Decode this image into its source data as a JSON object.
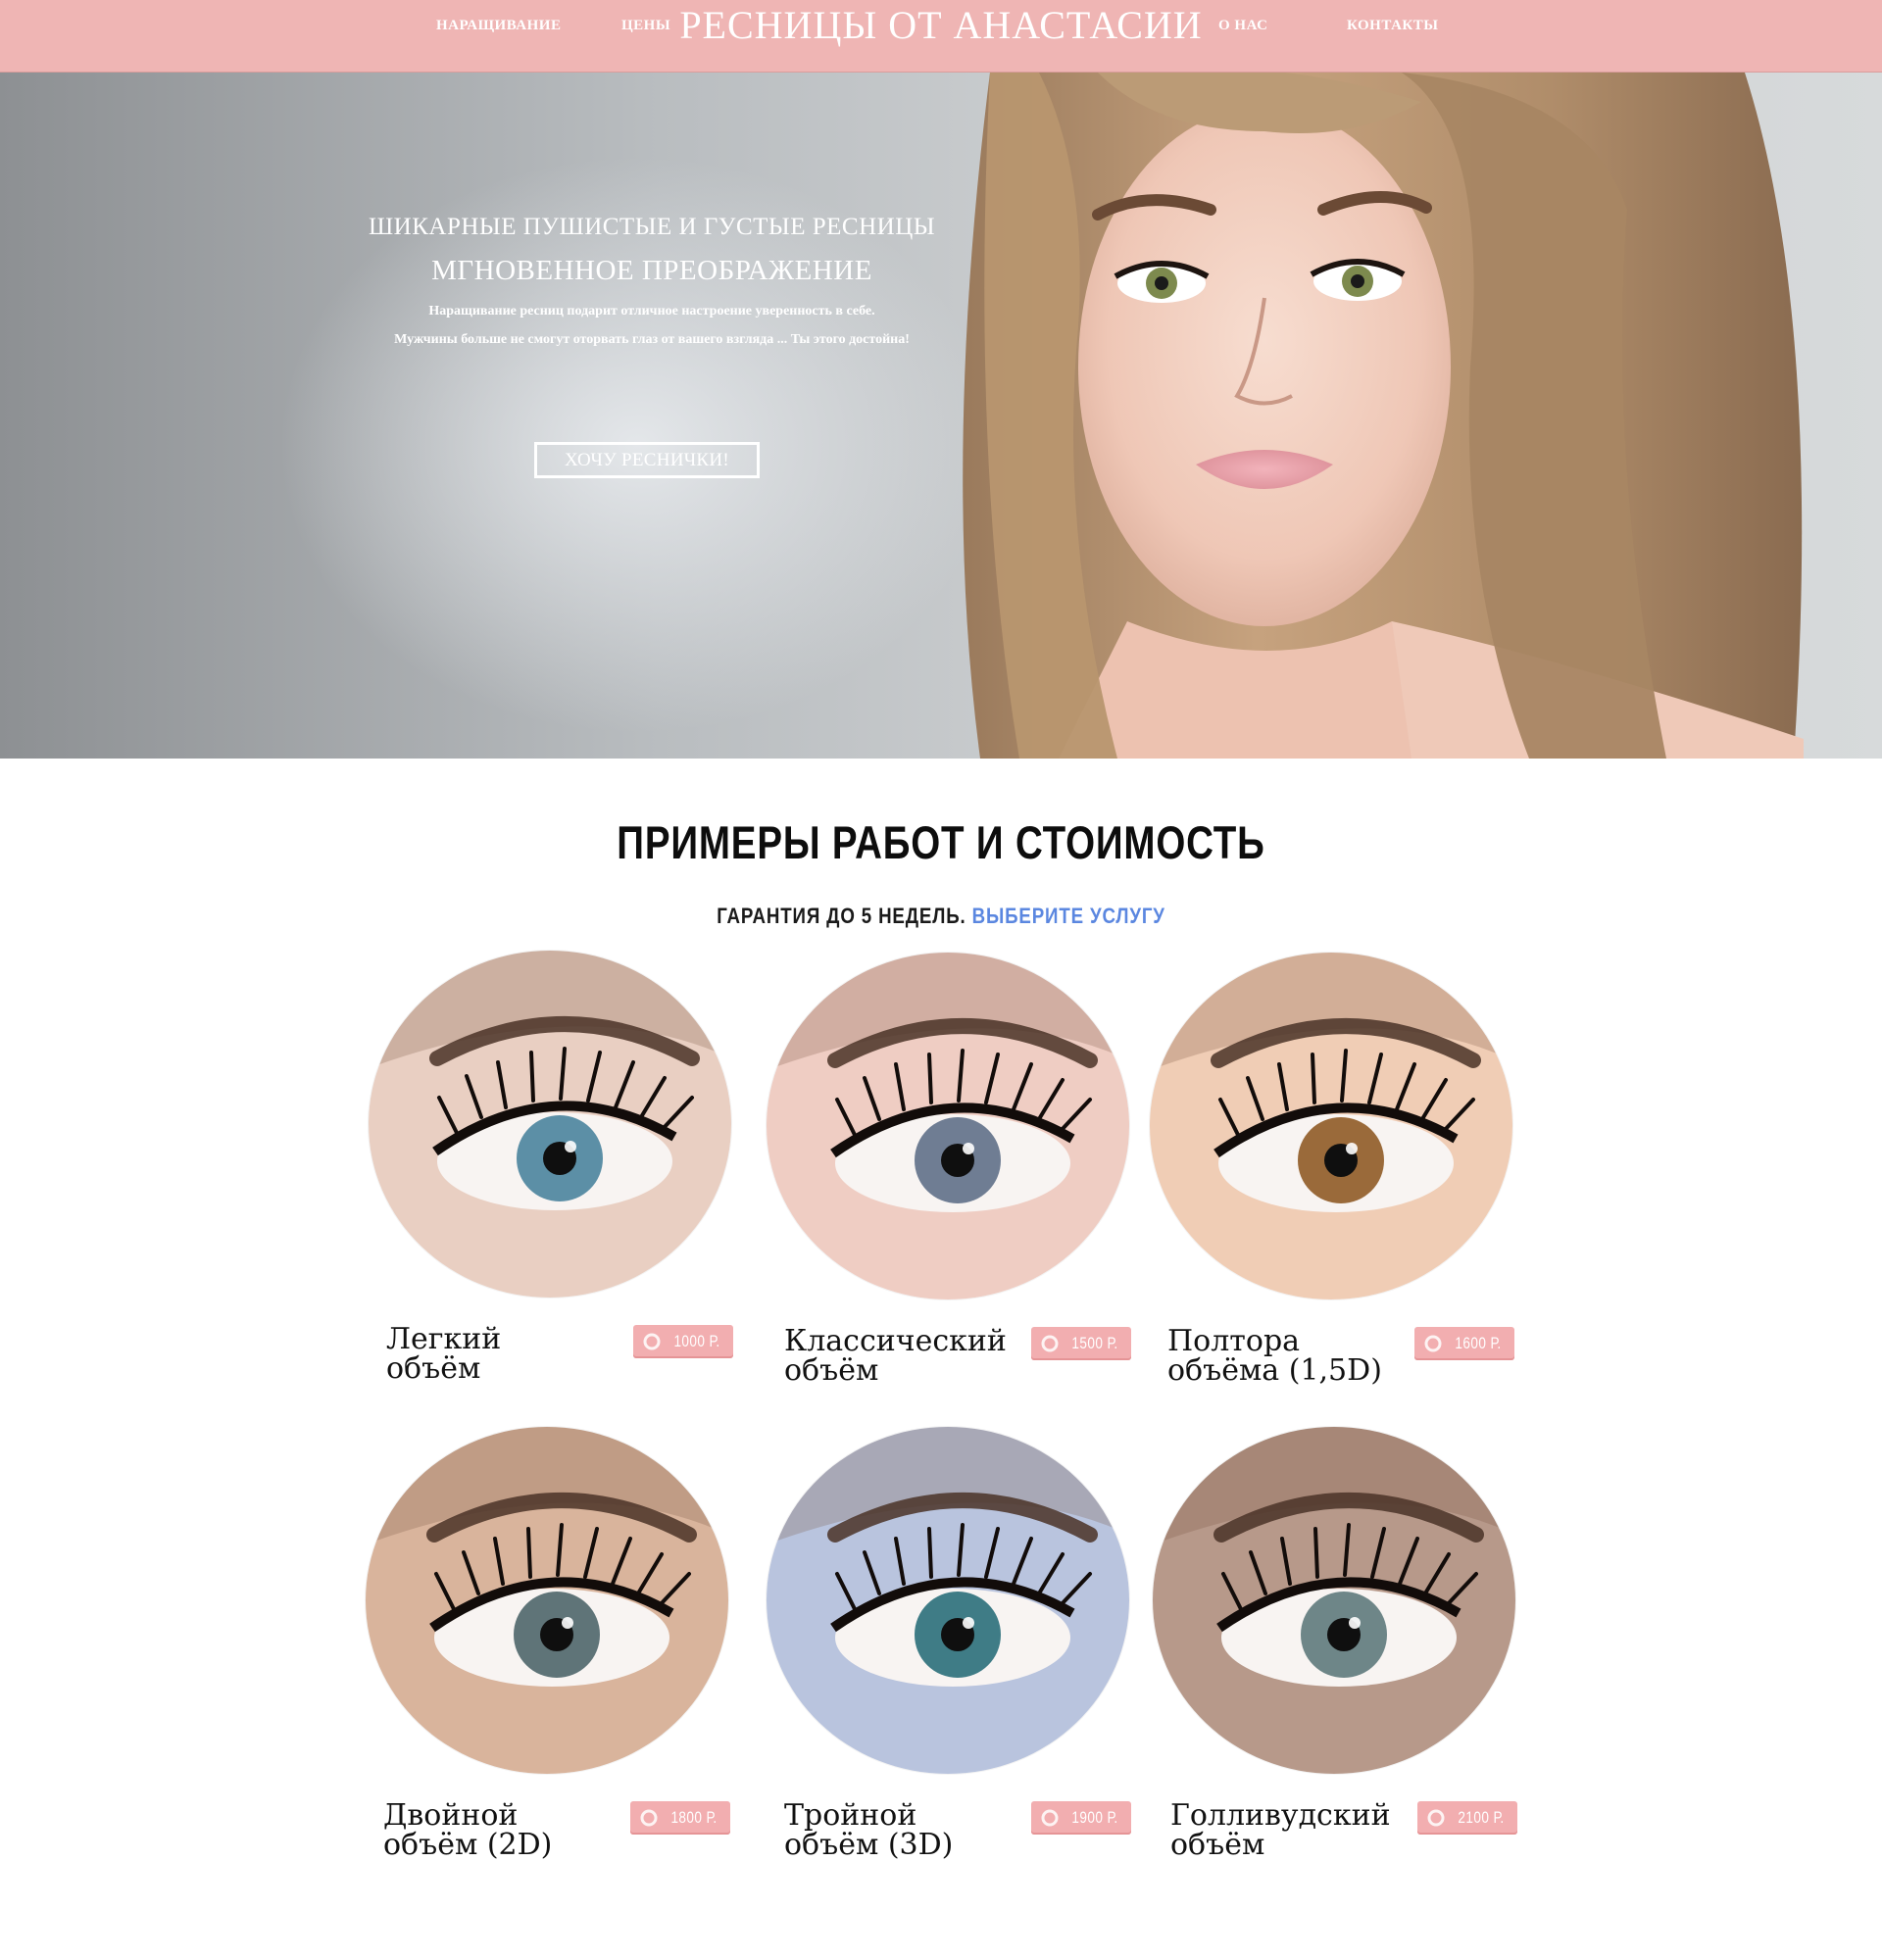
{
  "nav": {
    "left": [
      "НАРАЩИВАНИЕ",
      "ЦЕНЫ"
    ],
    "brand": "РЕСНИЦЫ ОТ АНАСТАСИИ",
    "right": [
      "О НАС",
      "КОНТАКТЫ"
    ]
  },
  "hero": {
    "headline": "ШИКАРНЫЕ ПУШИСТЫЕ И ГУСТЫЕ РЕСНИЦЫ",
    "subheadline": "МГНОВЕННОЕ ПРЕОБРАЖЕНИЕ",
    "line1": "Наращивание ресниц подарит отличное настроение уверенность в себе.",
    "line2": "Мужчины больше не смогут оторвать глаз от вашего взгляда ... Ты этого достойна!",
    "cta": "ХОЧУ РЕСНИЧКИ!"
  },
  "works": {
    "title": "ПРИМЕРЫ РАБОТ И СТОИМОСТЬ",
    "guarantee": "ГАРАНТИЯ ДО 5 НЕДЕЛЬ.",
    "choose": "ВЫБЕРИТЕ УСЛУГУ",
    "services": [
      {
        "name1": "Легкий",
        "name2": "объём",
        "price": "1000 Р.",
        "iris": "#5c8fa6",
        "skin": "#e9cfc2"
      },
      {
        "name1": "Классический",
        "name2": "объём",
        "price": "1500 Р.",
        "iris": "#6f7d93",
        "skin": "#efcdc3"
      },
      {
        "name1": "Полтора",
        "name2": "объёма (1,5D)",
        "price": "1600 Р.",
        "iris": "#9a6a3a",
        "skin": "#f0cdb5"
      },
      {
        "name1": "Двойной",
        "name2": "объём (2D)",
        "price": "1800 Р.",
        "iris": "#5f7478",
        "skin": "#d9b49c"
      },
      {
        "name1": "Тройной",
        "name2": "объём (3D)",
        "price": "1900 Р.",
        "iris": "#3f7c86",
        "skin": "#b9c4de"
      },
      {
        "name1": "Голливудский",
        "name2": "объём",
        "price": "2100 Р.",
        "iris": "#6e8688",
        "skin": "#b7998a"
      }
    ]
  },
  "colors": {
    "header_bg": "#efb5b4",
    "price_badge": "#f2aeb0",
    "accent_blue": "#5b87e0"
  }
}
